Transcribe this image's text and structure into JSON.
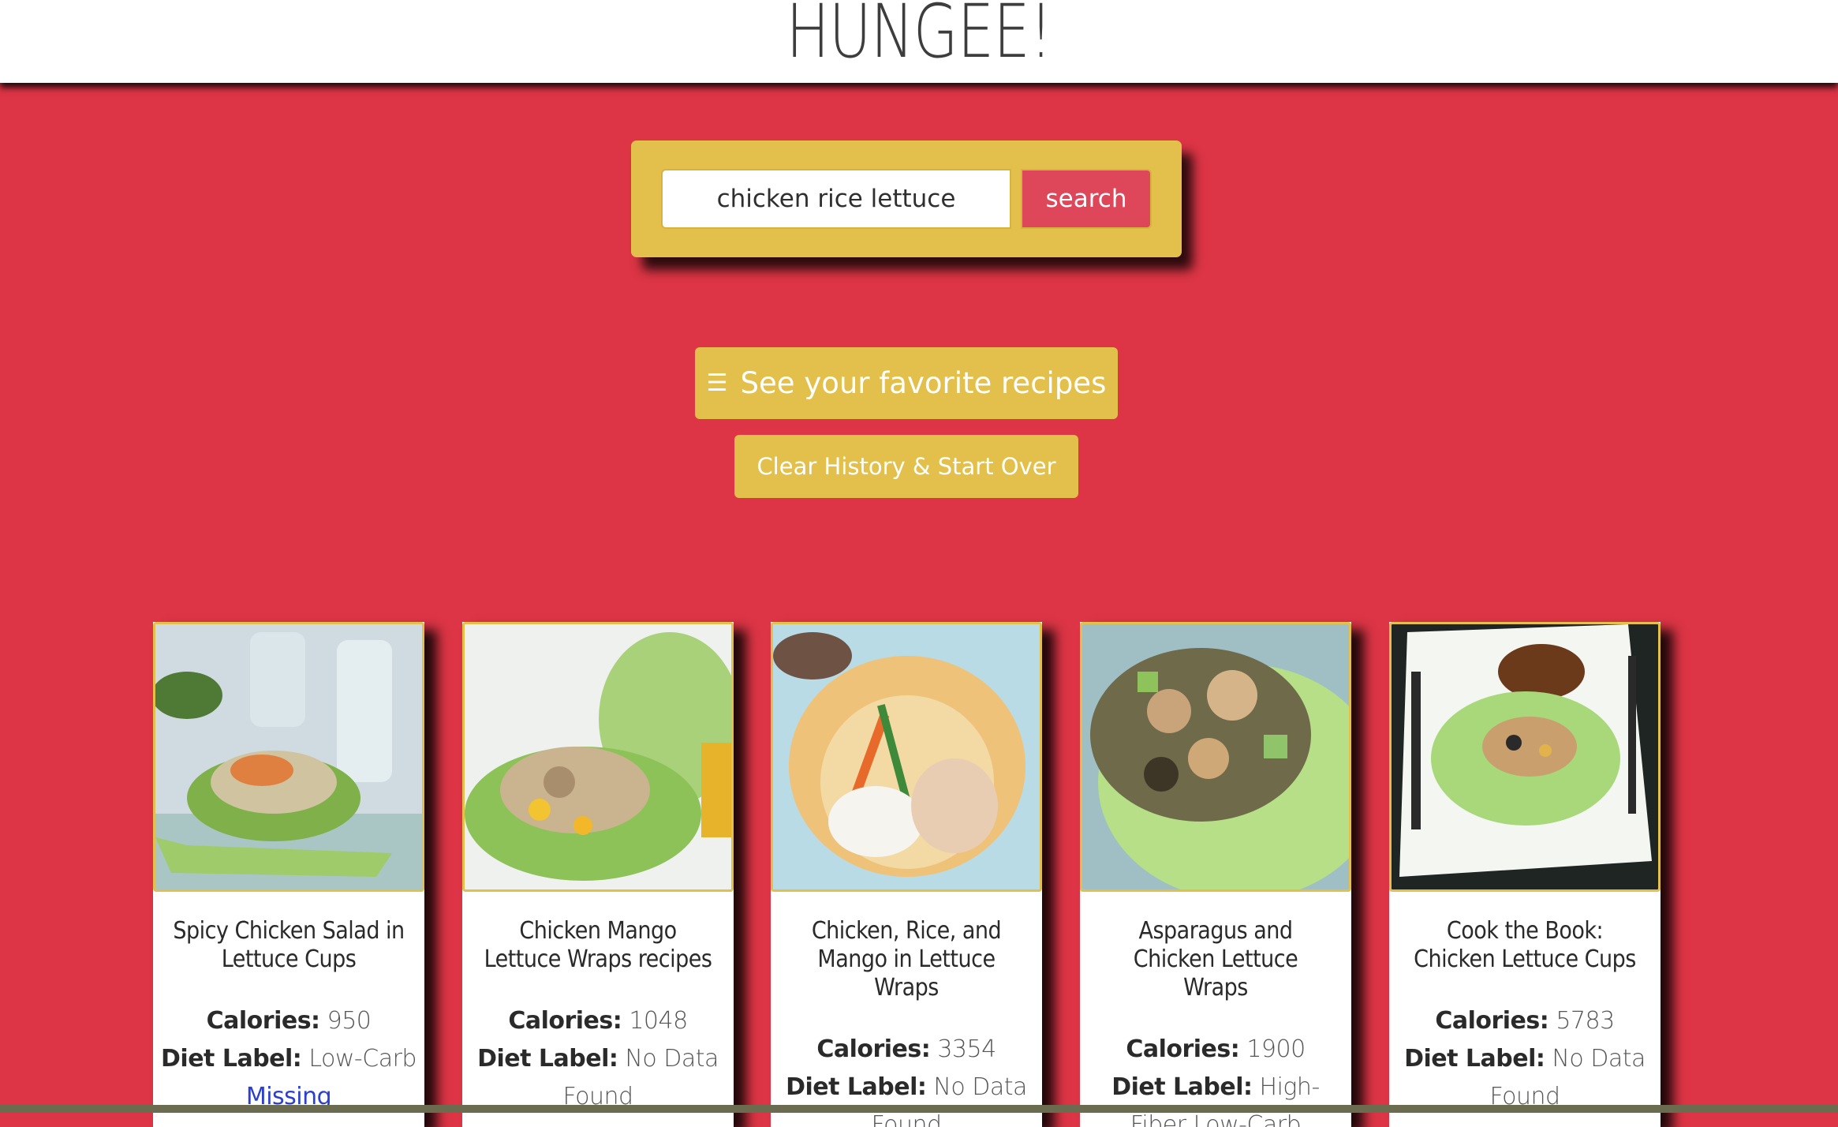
{
  "header": {
    "title": "HUNGEE!"
  },
  "search": {
    "value": "chicken rice lettuce",
    "button_label": "search"
  },
  "favorites_button": {
    "icon": "hamburger-menu-icon",
    "label": "See your favorite recipes"
  },
  "clear_button": {
    "label": "Clear History & Start Over"
  },
  "labels": {
    "calories": "Calories:",
    "diet": "Diet Label:"
  },
  "cards": [
    {
      "title": "Spicy Chicken Salad in Lettuce Cups",
      "calories": "950",
      "diet": "Low-Carb",
      "extra": "Missing"
    },
    {
      "title": "Chicken Mango Lettuce Wraps recipes",
      "calories": "1048",
      "diet": "No Data Found"
    },
    {
      "title": "Chicken, Rice, and Mango in Lettuce Wraps",
      "calories": "3354",
      "diet": "No Data Found"
    },
    {
      "title": "Asparagus and Chicken Lettuce Wraps",
      "calories": "1900",
      "diet": "High-Fiber,Low-Carb"
    },
    {
      "title": "Cook the Book: Chicken Lettuce Cups",
      "calories": "5783",
      "diet": "No Data Found"
    }
  ],
  "colors": {
    "background": "#dd3545",
    "accent": "#e3c04b",
    "search_button": "#dd4759"
  }
}
